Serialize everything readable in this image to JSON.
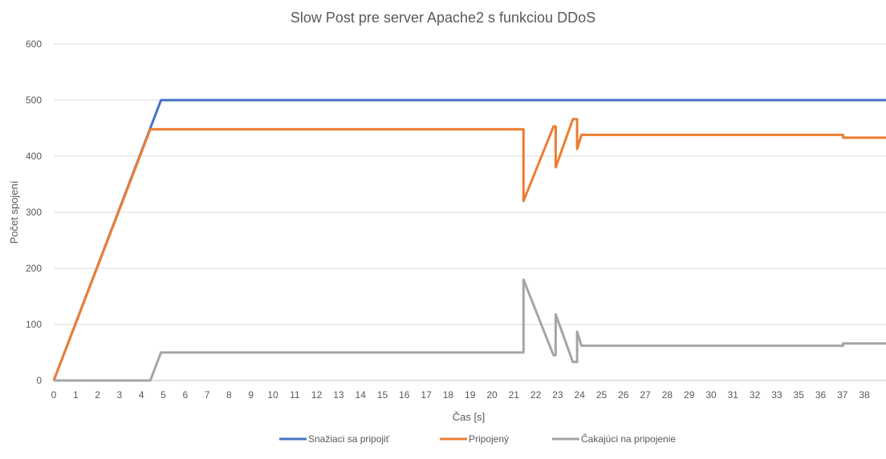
{
  "chart_data": {
    "type": "line",
    "title": "Slow Post pre server Apache2 s funkciou DDoS",
    "xlabel": "Čas [s]",
    "ylabel": "Počet spojení",
    "xlim": [
      0,
      38.8
    ],
    "ylim": [
      0,
      600
    ],
    "yticks": [
      "0",
      "100",
      "200",
      "300",
      "400",
      "500",
      "600"
    ],
    "xticks": [
      "0",
      "1",
      "2",
      "3",
      "4",
      "5",
      "6",
      "7",
      "8",
      "9",
      "10",
      "11",
      "12",
      "13",
      "14",
      "15",
      "16",
      "17",
      "18",
      "19",
      "20",
      "21",
      "22",
      "23",
      "24",
      "25",
      "26",
      "27",
      "28",
      "29",
      "30",
      "31",
      "32",
      "33",
      "35",
      "36",
      "37",
      "38"
    ],
    "grid": true,
    "legend_position": "bottom",
    "series": [
      {
        "name": "Snažiaci sa pripojiť",
        "color": "#4472C4",
        "points": [
          [
            0,
            0
          ],
          [
            4.5,
            450
          ],
          [
            5,
            500
          ],
          [
            38.8,
            500
          ]
        ]
      },
      {
        "name": "Pripojený",
        "color": "#ED7D31",
        "points": [
          [
            0,
            0
          ],
          [
            4.5,
            448
          ],
          [
            21.9,
            448
          ],
          [
            21.9,
            320
          ],
          [
            23.3,
            453
          ],
          [
            23.4,
            453
          ],
          [
            23.4,
            380
          ],
          [
            24.2,
            466
          ],
          [
            24.4,
            466
          ],
          [
            24.4,
            413
          ],
          [
            24.6,
            438
          ],
          [
            36.8,
            438
          ],
          [
            36.8,
            433
          ],
          [
            38.8,
            433
          ]
        ]
      },
      {
        "name": "Čakajúci na pripojenie",
        "color": "#A5A5A5",
        "points": [
          [
            0,
            0
          ],
          [
            4.5,
            0
          ],
          [
            5,
            50
          ],
          [
            21.9,
            50
          ],
          [
            21.9,
            180
          ],
          [
            23.3,
            45
          ],
          [
            23.4,
            45
          ],
          [
            23.4,
            118
          ],
          [
            24.2,
            33
          ],
          [
            24.4,
            33
          ],
          [
            24.4,
            87
          ],
          [
            24.6,
            62
          ],
          [
            36.8,
            62
          ],
          [
            36.8,
            66
          ],
          [
            38.8,
            66
          ]
        ]
      }
    ]
  }
}
